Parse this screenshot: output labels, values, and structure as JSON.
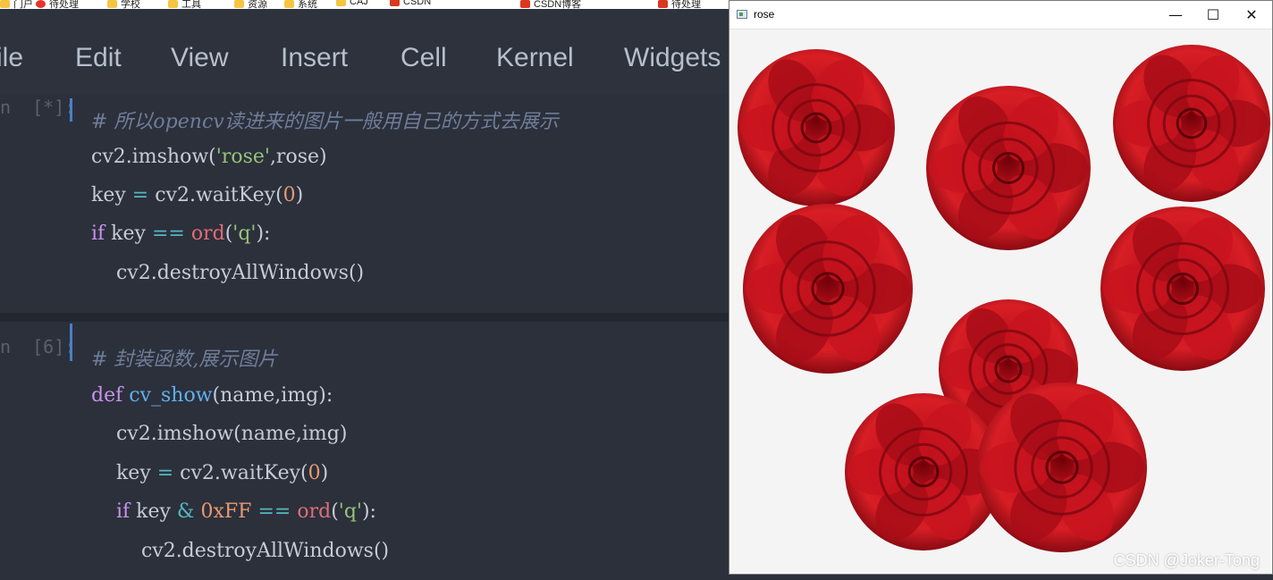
{
  "bookmarks": [
    "门户",
    "待处理",
    "学校",
    "工具",
    "资源",
    "系统",
    "CAJ",
    "CSDN",
    "CSDN博客",
    "待处理"
  ],
  "menu": {
    "items": [
      "ile",
      "Edit",
      "View",
      "Insert",
      "Cell",
      "Kernel",
      "Widgets"
    ]
  },
  "cells": [
    {
      "prompt": "n  [*]:",
      "lines": [
        [
          {
            "t": "# 所以opencv读进来的图片一般用自己的方式去展示",
            "c": "cm"
          }
        ],
        [
          {
            "t": "cv2.imshow(",
            "c": ""
          },
          {
            "t": "'rose'",
            "c": "st"
          },
          {
            "t": ",rose)",
            "c": ""
          }
        ],
        [
          {
            "t": "key ",
            "c": ""
          },
          {
            "t": "=",
            "c": "op"
          },
          {
            "t": " cv2.waitKey(",
            "c": ""
          },
          {
            "t": "0",
            "c": "nu"
          },
          {
            "t": ")",
            "c": ""
          }
        ],
        [
          {
            "t": "if",
            "c": "kw"
          },
          {
            "t": " key ",
            "c": ""
          },
          {
            "t": "==",
            "c": "op"
          },
          {
            "t": " ",
            "c": ""
          },
          {
            "t": "ord",
            "c": "bi"
          },
          {
            "t": "(",
            "c": ""
          },
          {
            "t": "'q'",
            "c": "st"
          },
          {
            "t": "):",
            "c": ""
          }
        ],
        [
          {
            "t": "    cv2.destroyAllWindows()",
            "c": ""
          }
        ]
      ]
    },
    {
      "prompt": "n  [6]:",
      "lines": [
        [
          {
            "t": "# 封装函数,展示图片",
            "c": "cm"
          }
        ],
        [
          {
            "t": "def",
            "c": "kw"
          },
          {
            "t": " ",
            "c": ""
          },
          {
            "t": "cv_show",
            "c": "fn"
          },
          {
            "t": "(name,img):",
            "c": ""
          }
        ],
        [
          {
            "t": "    cv2.imshow(name,img)",
            "c": ""
          }
        ],
        [
          {
            "t": "    key ",
            "c": ""
          },
          {
            "t": "=",
            "c": "op"
          },
          {
            "t": " cv2.waitKey(",
            "c": ""
          },
          {
            "t": "0",
            "c": "nu"
          },
          {
            "t": ")",
            "c": ""
          }
        ],
        [
          {
            "t": "    if",
            "c": "kw"
          },
          {
            "t": " key ",
            "c": ""
          },
          {
            "t": "&",
            "c": "op"
          },
          {
            "t": " ",
            "c": ""
          },
          {
            "t": "0xFF",
            "c": "nu"
          },
          {
            "t": " ",
            "c": ""
          },
          {
            "t": "==",
            "c": "op"
          },
          {
            "t": " ",
            "c": ""
          },
          {
            "t": "ord",
            "c": "bi"
          },
          {
            "t": "(",
            "c": ""
          },
          {
            "t": "'q'",
            "c": "st"
          },
          {
            "t": "):",
            "c": ""
          }
        ],
        [
          {
            "t": "        cv2.destroyAllWindows()",
            "c": ""
          }
        ]
      ]
    }
  ],
  "cv_window": {
    "title": "rose",
    "minimize_glyph": "—",
    "maximize_glyph": "☐",
    "close_glyph": "✕",
    "watermark": "CSDN @Joker-Tong",
    "icon": "opencv-window-icon"
  },
  "colors": {
    "editor_bg": "#2b303b",
    "menu_text": "#b7bfcc",
    "comment": "#6f7d99",
    "string": "#98c379",
    "keyword": "#c792ea",
    "function": "#61afef",
    "number": "#e89a6f",
    "rose_red": "#b0121b"
  }
}
